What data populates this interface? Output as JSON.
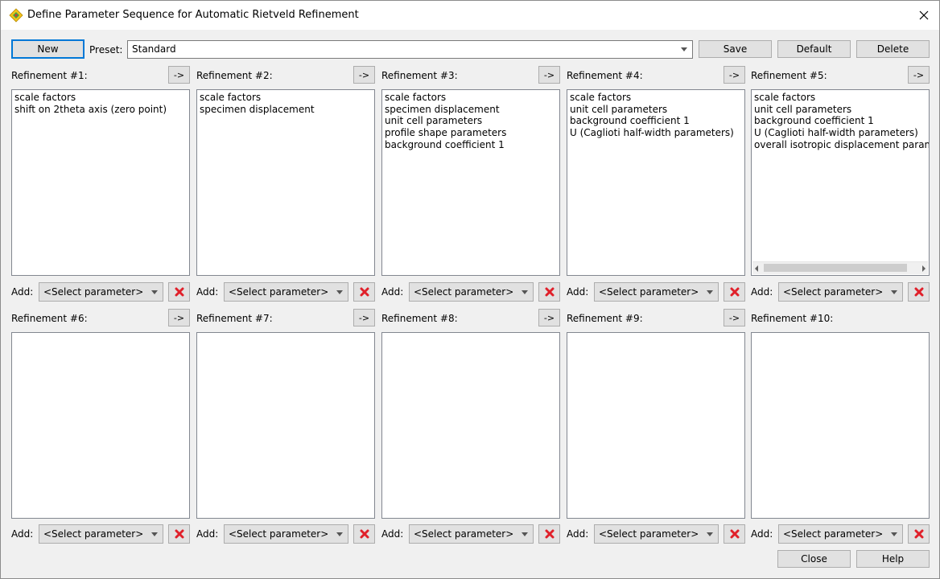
{
  "window": {
    "title": "Define Parameter Sequence for Automatic Rietveld Refinement"
  },
  "toolbar": {
    "new_label": "New",
    "preset_label": "Preset:",
    "preset_value": "Standard",
    "save_label": "Save",
    "default_label": "Default",
    "delete_label": "Delete"
  },
  "move_button_label": "->",
  "add_label": "Add:",
  "select_placeholder": "<Select parameter>",
  "refinements": [
    {
      "label": "Refinement #1:",
      "items": [
        "scale factors",
        "shift on 2theta axis (zero point)"
      ]
    },
    {
      "label": "Refinement #2:",
      "items": [
        "scale factors",
        "specimen displacement"
      ]
    },
    {
      "label": "Refinement #3:",
      "items": [
        "scale factors",
        "specimen displacement",
        "unit cell parameters",
        "profile shape parameters",
        "background coefficient 1"
      ]
    },
    {
      "label": "Refinement #4:",
      "items": [
        "scale factors",
        "unit cell parameters",
        "background coefficient 1",
        "U (Caglioti half-width parameters)"
      ]
    },
    {
      "label": "Refinement #5:",
      "items": [
        "scale factors",
        "unit cell parameters",
        "background coefficient 1",
        "U (Caglioti half-width parameters)",
        "overall isotropic displacement parameter"
      ]
    },
    {
      "label": "Refinement #6:",
      "items": []
    },
    {
      "label": "Refinement #7:",
      "items": []
    },
    {
      "label": "Refinement #8:",
      "items": []
    },
    {
      "label": "Refinement #9:",
      "items": []
    },
    {
      "label": "Refinement #10:",
      "items": []
    }
  ],
  "footer": {
    "close_label": "Close",
    "help_label": "Help"
  },
  "colors": {
    "delete_x": "#e0202a",
    "accent": "#0078d7"
  },
  "icons": {
    "app": "diamond-app-icon",
    "close": "close-icon",
    "delete": "red-x-icon",
    "dropdown": "chevron-down-icon",
    "scroll_left": "scroll-left-arrow-icon",
    "scroll_right": "scroll-right-arrow-icon"
  }
}
